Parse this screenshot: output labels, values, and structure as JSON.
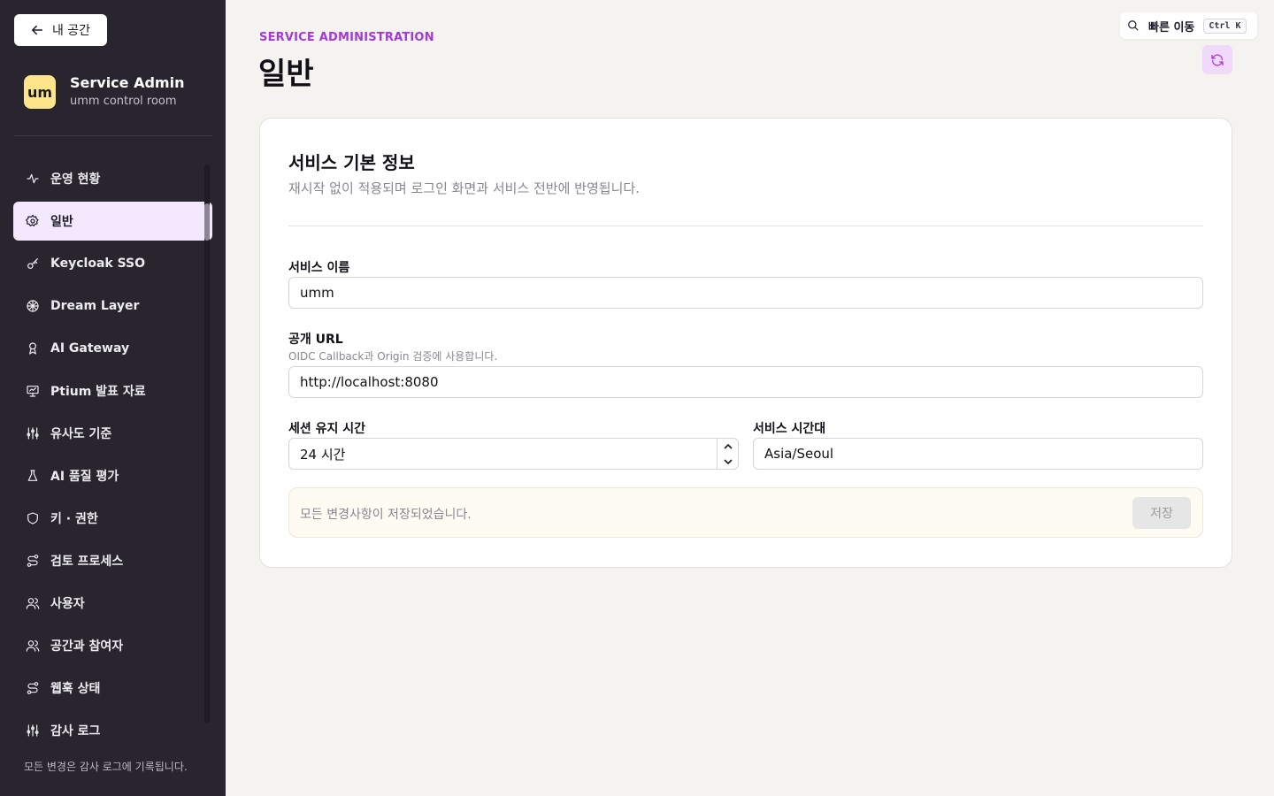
{
  "sidebar": {
    "back_label": "내 공간",
    "brand": {
      "logo_text": "um",
      "title": "Service Admin",
      "subtitle": "umm control room",
      "logo_color": "#fde68a"
    },
    "items": [
      {
        "label": "운영 현황",
        "icon": "activity-icon"
      },
      {
        "label": "일반",
        "icon": "gear-icon",
        "active": true
      },
      {
        "label": "Keycloak SSO",
        "icon": "key-icon"
      },
      {
        "label": "Dream Layer",
        "icon": "brain-icon"
      },
      {
        "label": "AI Gateway",
        "icon": "bot-icon"
      },
      {
        "label": "Ptium 발표 자료",
        "icon": "presentation-icon"
      },
      {
        "label": "유사도 기준",
        "icon": "sliders-icon"
      },
      {
        "label": "AI 품질 평가",
        "icon": "flask-icon"
      },
      {
        "label": "키 · 권한",
        "icon": "shield-icon"
      },
      {
        "label": "검토 프로세스",
        "icon": "route-icon"
      },
      {
        "label": "사용자",
        "icon": "users-icon"
      },
      {
        "label": "공간과 참여자",
        "icon": "users-icon"
      },
      {
        "label": "웹훅 상태",
        "icon": "route-icon"
      },
      {
        "label": "감사 로그",
        "icon": "sliders-icon"
      }
    ],
    "footer": "모든 변경은 감사 로그에 기록됩니다."
  },
  "header": {
    "eyebrow": "SERVICE ADMINISTRATION",
    "title": "일반",
    "quick_label": "빠른 이동",
    "quick_shortcut": "Ctrl K",
    "accent": "#a43ad6"
  },
  "card": {
    "title": "서비스 기본 정보",
    "description": "재시작 없이 적용되며 로그인 화면과 서비스 전반에 반영됩니다.",
    "fields": {
      "service_name": {
        "label": "서비스 이름",
        "value": "umm"
      },
      "public_url": {
        "label": "공개 URL",
        "hint": "OIDC Callback과 Origin 검증에 사용합니다.",
        "value": "http://localhost:8080"
      },
      "session": {
        "label": "세션 유지 시간",
        "value": "24 시간"
      },
      "timezone": {
        "label": "서비스 시간대",
        "value": "Asia/Seoul"
      }
    },
    "save_status": "모든 변경사항이 저장되었습니다.",
    "save_label": "저장"
  }
}
